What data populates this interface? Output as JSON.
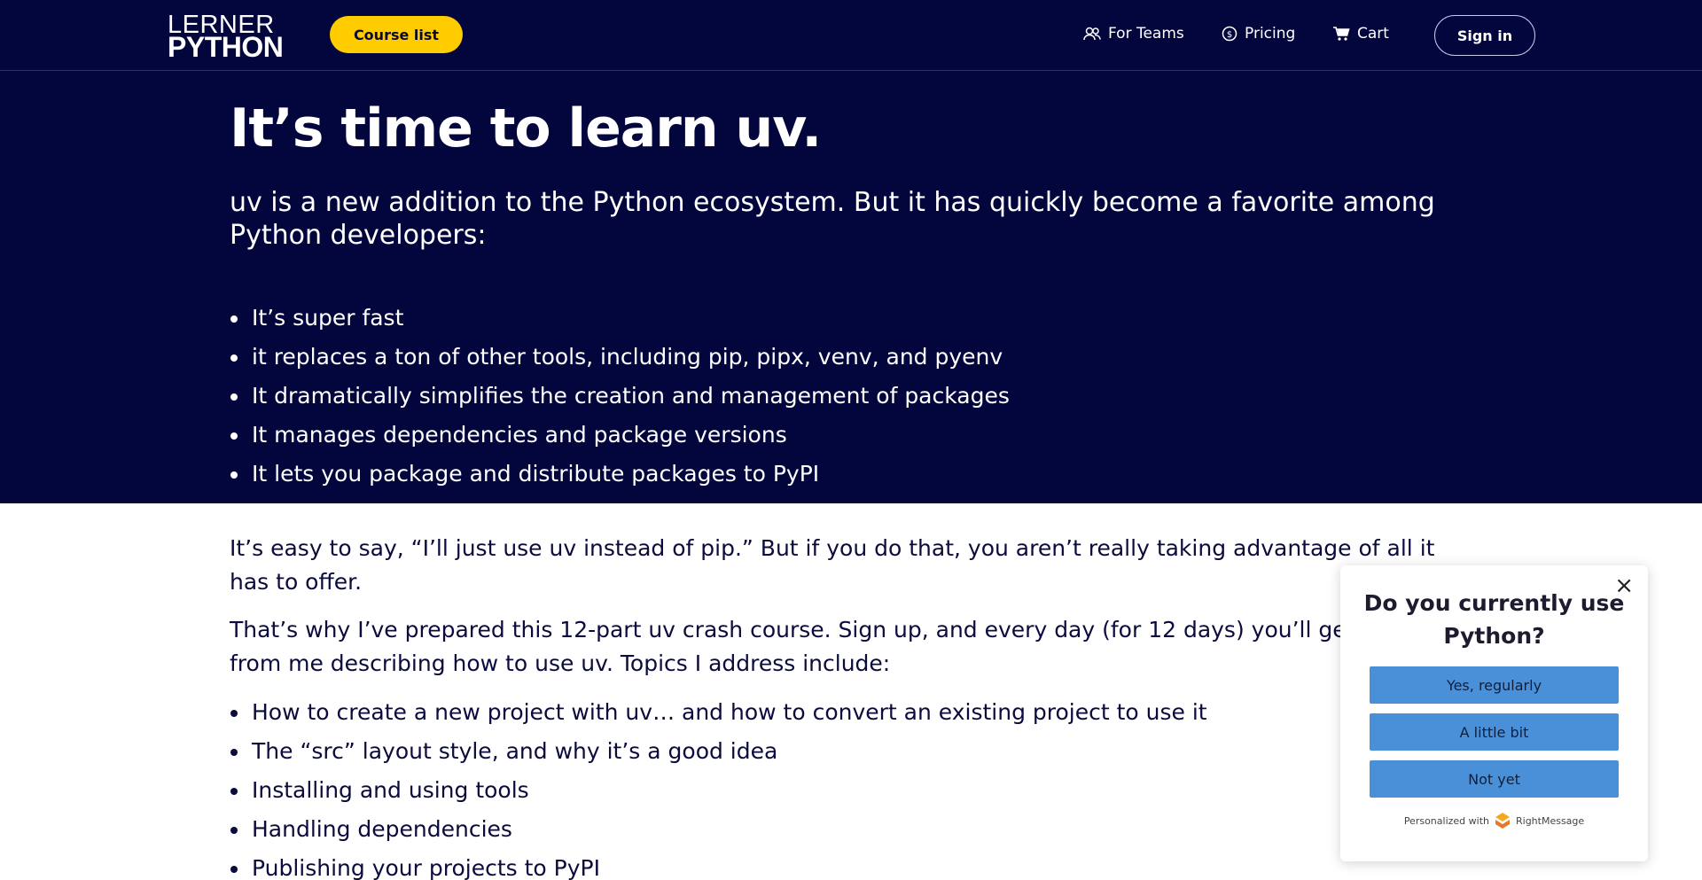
{
  "header": {
    "logo_top": "LERNER",
    "logo_bottom": "PYTHON",
    "course_list_label": "Course list",
    "nav": [
      {
        "label": "For Teams",
        "icon": "team-icon"
      },
      {
        "label": "Pricing",
        "icon": "dollar-icon"
      },
      {
        "label": "Cart",
        "icon": "cart-icon"
      }
    ],
    "signin_label": "Sign in"
  },
  "hero": {
    "title": "It’s time to learn uv.",
    "intro": "uv is a new addition to the Python ecosystem. But it has quickly become a favorite among Python developers:",
    "bullets": [
      "It’s super fast",
      "it replaces a ton of other tools, including pip, pipx, venv, and pyenv",
      "It dramatically simplifies the creation and management of packages",
      "It manages dependencies and package versions",
      "It lets you package and distribute packages to PyPI"
    ]
  },
  "body": {
    "para1": "It’s easy to say, “I’ll just use uv instead of pip.” But if you do that, you aren’t really taking advantage of all it has to offer.",
    "para2": "That’s why I’ve prepared this 12-part uv crash course. Sign up, and every day (for 12 days) you’ll get a new from me describing how to use uv. Topics I address include:",
    "bullets": [
      "How to create a new project with uv… and how to convert an existing project to use it",
      "The “src” layout style, and why it’s a good idea",
      "Installing and using tools",
      "Handling dependencies",
      "Publishing your projects to PyPI"
    ]
  },
  "popup": {
    "close": "×",
    "question": "Do you currently use Python?",
    "options": [
      "Yes, regularly",
      "A little bit",
      "Not yet"
    ],
    "footer_prefix": "Personalized with",
    "footer_brand": "RightMessage"
  },
  "colors": {
    "navy": "#03053d",
    "yellow": "#ffcc00",
    "option_blue": "#4a90d9"
  }
}
